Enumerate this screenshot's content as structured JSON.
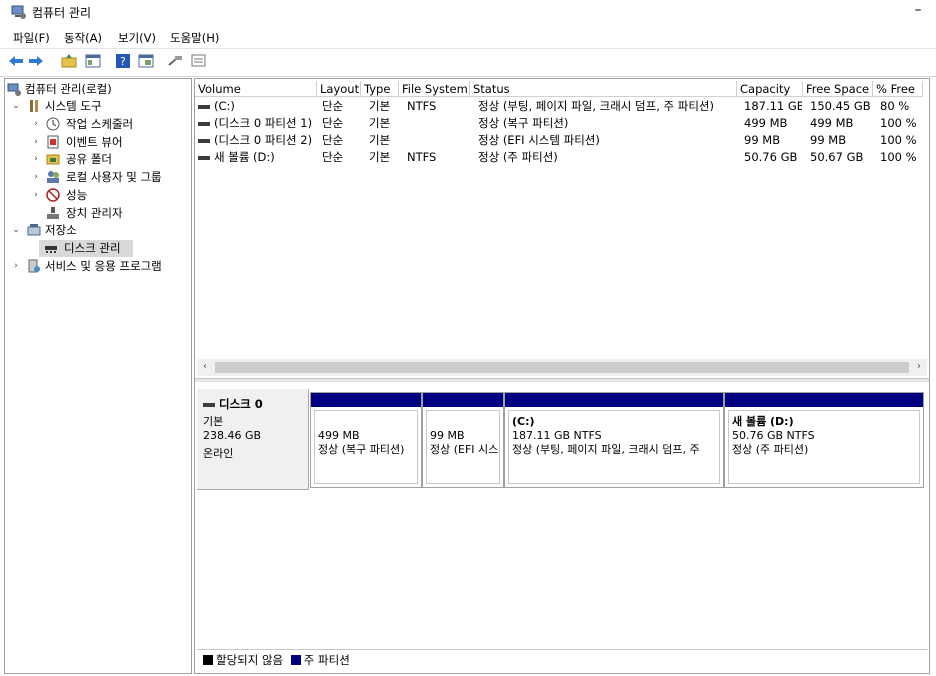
{
  "window": {
    "title": "컴퓨터 관리",
    "minimize": "–"
  },
  "menu": [
    "파일(F)",
    "동작(A)",
    "보기(V)",
    "도움말(H)"
  ],
  "toolbar": [
    "back-arrow-icon",
    "forward-arrow-icon",
    "folder-up-icon",
    "show-hide-tree-icon",
    "help-icon",
    "properties-icon",
    "connect-icon",
    "list-view-icon"
  ],
  "tree": {
    "root": "컴퓨터 관리(로컬)",
    "system_tools": "시스템 도구",
    "task_scheduler": "작업 스케줄러",
    "event_viewer": "이벤트 뷰어",
    "shared_folders": "공유 폴더",
    "local_users": "로컬 사용자 및 그룹",
    "performance": "성능",
    "device_manager": "장치 관리자",
    "storage": "저장소",
    "disk_management": "디스크 관리",
    "services": "서비스 및 응용 프로그램"
  },
  "volume_table": {
    "headers": [
      "Volume",
      "Layout",
      "Type",
      "File System",
      "Status",
      "Capacity",
      "Free Space",
      "% Free"
    ],
    "rows": [
      [
        "(C:)",
        "단순",
        "기본",
        "NTFS",
        "정상 (부팅, 페이지 파일, 크래시 덤프, 주 파티션)",
        "187.11 GB",
        "150.45 GB",
        "80 %"
      ],
      [
        "(디스크 0 파티션 1)",
        "단순",
        "기본",
        "",
        "정상 (복구 파티션)",
        "499 MB",
        "499 MB",
        "100 %"
      ],
      [
        "(디스크 0 파티션 2)",
        "단순",
        "기본",
        "",
        "정상 (EFI 시스템 파티션)",
        "99 MB",
        "99 MB",
        "100 %"
      ],
      [
        "새 볼륨 (D:)",
        "단순",
        "기본",
        "NTFS",
        "정상 (주 파티션)",
        "50.76 GB",
        "50.67 GB",
        "100 %"
      ]
    ]
  },
  "scroll": {
    "left": "‹",
    "right": "›"
  },
  "disk": {
    "name": "디스크 0",
    "type": "기본",
    "size": "238.46 GB",
    "status": "온라인",
    "partitions": [
      {
        "title": "",
        "size": "499 MB",
        "status": "정상 (복구 파티션)"
      },
      {
        "title": "",
        "size": "99 MB",
        "status": "정상 (EFI 시스"
      },
      {
        "title": "(C:)",
        "size": "187.11 GB NTFS",
        "status": "정상 (부팅, 페이지 파일, 크래시 덤프, 주"
      },
      {
        "title": "새 볼륨  (D:)",
        "size": "50.76 GB NTFS",
        "status": "정상 (주 파티션)"
      }
    ]
  },
  "legend": {
    "unallocated": "할당되지 않음",
    "primary": "주 파티션"
  },
  "colors": {
    "partition_bar": "#000080",
    "unallocated": "#000000",
    "selection": "#d9d9d9"
  }
}
